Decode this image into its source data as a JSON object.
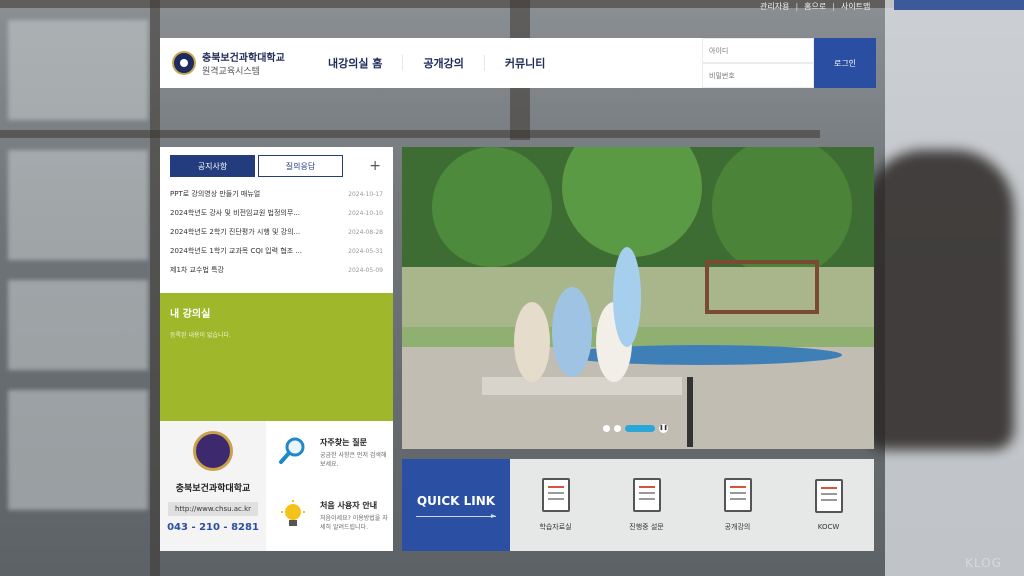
{
  "top_links": [
    "관리자용",
    "홈으로",
    "사이트맵"
  ],
  "header": {
    "school_name": "충북보건과학대학교",
    "system_name": "원격교육시스템",
    "nav": [
      "내강의실 홈",
      "공개강의",
      "커뮤니티"
    ],
    "id_placeholder": "아이디",
    "pw_placeholder": "비밀번호",
    "login_label": "로그인"
  },
  "notice": {
    "tabs": [
      "공지사항",
      "질의응답"
    ],
    "plus": "+",
    "items": [
      {
        "title": "PPT로 강의영상 만들기 매뉴얼",
        "date": "2024-10-17"
      },
      {
        "title": "2024학년도 강사 및 비전임교원 법정의무...",
        "date": "2024-10-10"
      },
      {
        "title": "2024학년도 2학기 진단평가 시행 및 강의...",
        "date": "2024-08-28"
      },
      {
        "title": "2024학년도 1학기 교과목 CQI 입력 협조 ...",
        "date": "2024-05-31"
      },
      {
        "title": "제1차 교수법 특강",
        "date": "2024-05-09"
      }
    ]
  },
  "lecture": {
    "title": "내 강의실",
    "subtitle": "등록된 내용이 없습니다."
  },
  "school": {
    "name": "충북보건과학대학교",
    "url": "http://www.chsu.ac.kr",
    "tel": "043 - 210 - 8281"
  },
  "help": {
    "faq_title": "자주찾는 질문",
    "faq_desc": "궁금한 사항은 먼저 검색해 보세요.",
    "guide_title": "처음 사용자 안내",
    "guide_desc": "처음이세요? 이용방법을 자세히 알려드립니다."
  },
  "quick_link": {
    "label": "QUICK LINK",
    "items": [
      "학습자료실",
      "진행중 설문",
      "공개강의",
      "KOCW"
    ]
  },
  "watermark": "KLOG",
  "colors": {
    "primary": "#2a4fa2",
    "lecture_green": "#9fb72a",
    "dark_navy": "#233c7e"
  }
}
